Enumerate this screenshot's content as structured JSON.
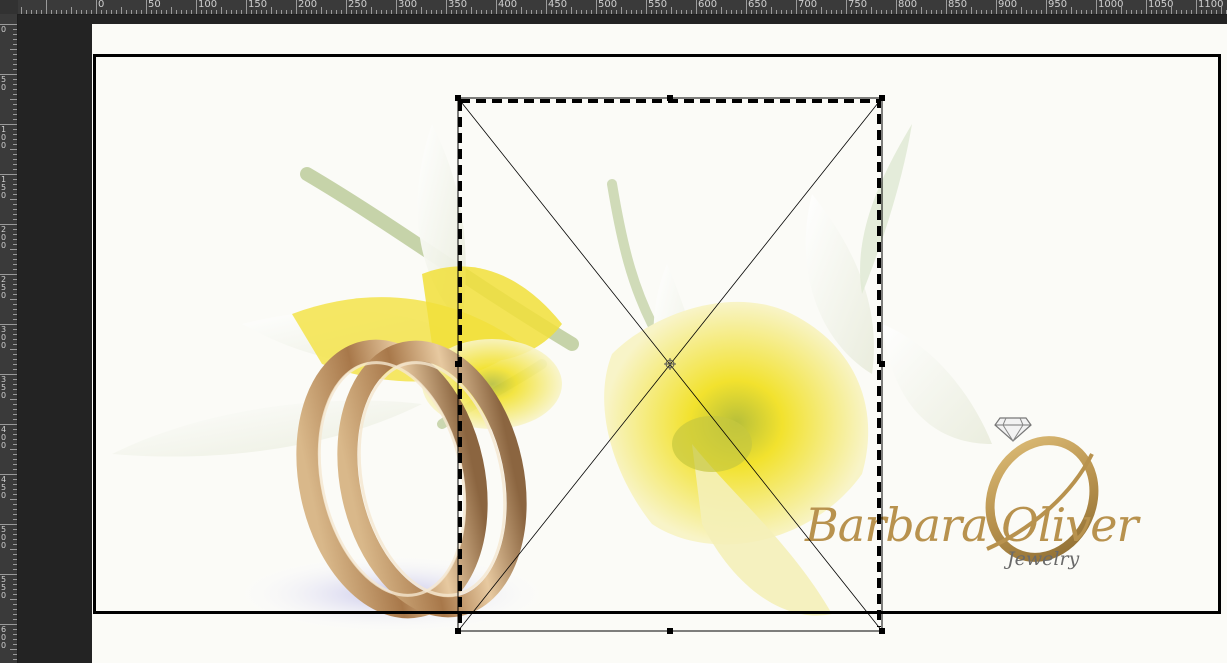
{
  "ruler": {
    "horizontal": [
      "0",
      "50",
      "100",
      "150",
      "200",
      "250",
      "300",
      "350",
      "400",
      "450",
      "500",
      "550",
      "600",
      "650",
      "700",
      "750",
      "800",
      "850",
      "900",
      "950",
      "1000",
      "1050",
      "1100"
    ],
    "vertical": [
      "0",
      "50",
      "100",
      "150",
      "200",
      "250",
      "300",
      "350",
      "400",
      "450",
      "500",
      "550",
      "600"
    ]
  },
  "artwork": {
    "logo": {
      "name": "Barbara Oliver",
      "subtitle": "Jewelry"
    }
  },
  "colors": {
    "flower_yellow": "#f2e22e",
    "flower_white": "#f7f7ee",
    "stem_green": "#9bb36a",
    "ring_gold": "#c9a16a",
    "logo_gold": "#b8924e",
    "selection": "#000000"
  },
  "icons": [
    "diamond-icon",
    "transform-handle-icon",
    "crosshair-icon"
  ]
}
